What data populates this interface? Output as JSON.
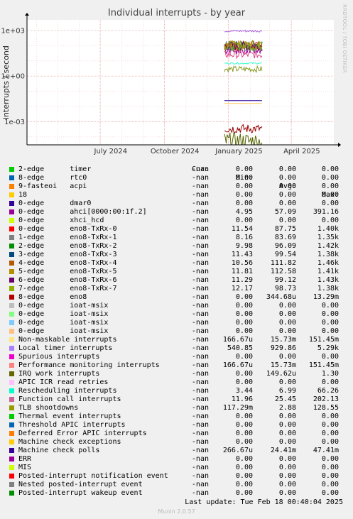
{
  "title": "Individual interrupts - by year",
  "side_label": "RRDTOOL / TOBI OETIKER",
  "footer": {
    "last_update": "Last update: Tue Feb 18 00:40:04 2025",
    "munin": "Munin 2.0.57"
  },
  "legend_header": {
    "cur": "Cur:",
    "min": "Min:",
    "avg": "Avg:",
    "max": "Max:"
  },
  "chart_data": {
    "type": "line",
    "title": "Individual interrupts - by year",
    "ylabel": "interrupts / second",
    "yscale": "log",
    "ylim": [
      3e-05,
      5000
    ],
    "yticks": [
      "1e+03",
      "1e+00",
      "1e-03"
    ],
    "xticks": [
      "July 2024",
      "October 2024",
      "January 2025",
      "April 2025"
    ],
    "grid": true,
    "data_start": "2024-12-26",
    "series": [
      {
        "name": "0-edge ahci[0000:00:1f.2]",
        "color": "#990099",
        "level": 57.09,
        "spread": 0.35
      },
      {
        "name": "0-edge eno8-TxRx-0",
        "color": "#ee1111",
        "level": 87.75,
        "spread": 0.3
      },
      {
        "name": "1-edge eno8-TxRx-1",
        "color": "#888888",
        "level": 83.69,
        "spread": 0.3
      },
      {
        "name": "2-edge eno8-TxRx-2",
        "color": "#228b22",
        "level": 96.09,
        "spread": 0.3
      },
      {
        "name": "3-edge eno8-TxRx-3",
        "color": "#336666",
        "level": 99.54,
        "spread": 0.3
      },
      {
        "name": "4-edge eno8-TxRx-4",
        "color": "#cc6600",
        "level": 111.82,
        "spread": 0.3
      },
      {
        "name": "5-edge eno8-TxRx-5",
        "color": "#aa9900",
        "level": 112.58,
        "spread": 0.3
      },
      {
        "name": "6-edge eno8-TxRx-6",
        "color": "#660066",
        "level": 99.12,
        "spread": 0.3
      },
      {
        "name": "7-edge eno8-TxRx-7",
        "color": "#88aa22",
        "level": 98.73,
        "spread": 0.3
      },
      {
        "name": "Local timer interrupts",
        "color": "#aa66dd",
        "level": 929.86,
        "spread": 0.08
      },
      {
        "name": "TLB shootdowns",
        "color": "#889922",
        "level": 2.88,
        "spread": 0.2
      },
      {
        "name": "Rescheduling interrupts",
        "color": "#33ffcc",
        "level": 6.99,
        "spread": 0.05
      },
      {
        "name": "Function call interrupts",
        "color": "#dd4488",
        "level": 25.45,
        "spread": 0.25
      },
      {
        "name": "Machine check polls",
        "color": "#220099",
        "level": 0.02441,
        "spread": 0.0
      },
      {
        "name": "8-edge eno8",
        "color": "#990000",
        "level": 0.00034468,
        "spread": 0.3
      },
      {
        "name": "IRQ work interrupts",
        "color": "#556600",
        "level": 5e-05,
        "spread": 0.6
      },
      {
        "name": "Non-maskable interrupts",
        "color": "#ffcc66",
        "level": 0.01573,
        "spread": 0.0
      }
    ]
  },
  "legend": [
    {
      "color": "#00cc00",
      "name": "2-edge      timer",
      "cur": "-nan",
      "min": "0.00",
      "avg": "0.00",
      "max": "0.00"
    },
    {
      "color": "#0066b3",
      "name": "8-edge      rtc0",
      "cur": "-nan",
      "min": "0.00",
      "avg": "0.00",
      "max": "0.00"
    },
    {
      "color": "#ff8000",
      "name": "9-fasteoi   acpi",
      "cur": "-nan",
      "min": "0.00",
      "avg": "0.00",
      "max": "0.00"
    },
    {
      "color": "#ffcc00",
      "name": "18",
      "cur": "-nan",
      "min": "0.00",
      "avg": "0.00",
      "max": "0.00"
    },
    {
      "color": "#330099",
      "name": "0-edge      dmar0",
      "cur": "-nan",
      "min": "0.00",
      "avg": "0.00",
      "max": "0.00"
    },
    {
      "color": "#990099",
      "name": "0-edge      ahci[0000:00:1f.2]",
      "cur": "-nan",
      "min": "4.95",
      "avg": "57.09",
      "max": "391.16"
    },
    {
      "color": "#ccff00",
      "name": "0-edge      xhci_hcd",
      "cur": "-nan",
      "min": "0.00",
      "avg": "0.00",
      "max": "0.00"
    },
    {
      "color": "#ff0000",
      "name": "0-edge      eno8-TxRx-0",
      "cur": "-nan",
      "min": "11.54",
      "avg": "87.75",
      "max": "1.40k"
    },
    {
      "color": "#808080",
      "name": "1-edge      eno8-TxRx-1",
      "cur": "-nan",
      "min": "8.16",
      "avg": "83.69",
      "max": "1.35k"
    },
    {
      "color": "#008f00",
      "name": "2-edge      eno8-TxRx-2",
      "cur": "-nan",
      "min": "9.98",
      "avg": "96.09",
      "max": "1.42k"
    },
    {
      "color": "#00487d",
      "name": "3-edge      eno8-TxRx-3",
      "cur": "-nan",
      "min": "11.43",
      "avg": "99.54",
      "max": "1.38k"
    },
    {
      "color": "#b35a00",
      "name": "4-edge      eno8-TxRx-4",
      "cur": "-nan",
      "min": "10.56",
      "avg": "111.82",
      "max": "1.46k"
    },
    {
      "color": "#b38f00",
      "name": "5-edge      eno8-TxRx-5",
      "cur": "-nan",
      "min": "11.81",
      "avg": "112.58",
      "max": "1.41k"
    },
    {
      "color": "#6b006b",
      "name": "6-edge      eno8-TxRx-6",
      "cur": "-nan",
      "min": "11.29",
      "avg": "99.12",
      "max": "1.43k"
    },
    {
      "color": "#8fb300",
      "name": "7-edge      eno8-TxRx-7",
      "cur": "-nan",
      "min": "12.17",
      "avg": "98.73",
      "max": "1.38k"
    },
    {
      "color": "#b30000",
      "name": "8-edge      eno8",
      "cur": "-nan",
      "min": "0.00",
      "avg": "344.68u",
      "max": "13.29m"
    },
    {
      "color": "#bebebe",
      "name": "0-edge      ioat-msix",
      "cur": "-nan",
      "min": "0.00",
      "avg": "0.00",
      "max": "0.00"
    },
    {
      "color": "#80ff80",
      "name": "0-edge      ioat-msix",
      "cur": "-nan",
      "min": "0.00",
      "avg": "0.00",
      "max": "0.00"
    },
    {
      "color": "#80c9ff",
      "name": "0-edge      ioat-msix",
      "cur": "-nan",
      "min": "0.00",
      "avg": "0.00",
      "max": "0.00"
    },
    {
      "color": "#ffc080",
      "name": "0-edge      ioat-msix",
      "cur": "-nan",
      "min": "0.00",
      "avg": "0.00",
      "max": "0.00"
    },
    {
      "color": "#ffe680",
      "name": "Non-maskable interrupts",
      "cur": "-nan",
      "min": "166.67u",
      "avg": "15.73m",
      "max": "151.45m"
    },
    {
      "color": "#aa80ff",
      "name": "Local timer interrupts",
      "cur": "-nan",
      "min": "540.85",
      "avg": "929.86",
      "max": "5.29k"
    },
    {
      "color": "#ee00cc",
      "name": "Spurious interrupts",
      "cur": "-nan",
      "min": "0.00",
      "avg": "0.00",
      "max": "0.00"
    },
    {
      "color": "#ff8080",
      "name": "Performance monitoring interrupts",
      "cur": "-nan",
      "min": "166.67u",
      "avg": "15.73m",
      "max": "151.45m"
    },
    {
      "color": "#666600",
      "name": "IRQ work interrupts",
      "cur": "-nan",
      "min": "0.00",
      "avg": "149.62u",
      "max": "1.30"
    },
    {
      "color": "#ffbfff",
      "name": "APIC ICR read retries",
      "cur": "-nan",
      "min": "0.00",
      "avg": "0.00",
      "max": "0.00"
    },
    {
      "color": "#00ffcc",
      "name": "Rescheduling interrupts",
      "cur": "-nan",
      "min": "3.44",
      "avg": "6.99",
      "max": "66.26"
    },
    {
      "color": "#cc6699",
      "name": "Function call interrupts",
      "cur": "-nan",
      "min": "11.96",
      "avg": "25.45",
      "max": "202.13"
    },
    {
      "color": "#999900",
      "name": "TLB shootdowns",
      "cur": "-nan",
      "min": "117.29m",
      "avg": "2.88",
      "max": "128.55"
    },
    {
      "color": "#00cc00",
      "name": "Thermal event interrupts",
      "cur": "-nan",
      "min": "0.00",
      "avg": "0.00",
      "max": "0.00"
    },
    {
      "color": "#0066b3",
      "name": "Threshold APIC interrupts",
      "cur": "-nan",
      "min": "0.00",
      "avg": "0.00",
      "max": "0.00"
    },
    {
      "color": "#ff8000",
      "name": "Deferred Error APIC interrupts",
      "cur": "-nan",
      "min": "0.00",
      "avg": "0.00",
      "max": "0.00"
    },
    {
      "color": "#ffcc00",
      "name": "Machine check exceptions",
      "cur": "-nan",
      "min": "0.00",
      "avg": "0.00",
      "max": "0.00"
    },
    {
      "color": "#330099",
      "name": "Machine check polls",
      "cur": "-nan",
      "min": "266.67u",
      "avg": "24.41m",
      "max": "47.41m"
    },
    {
      "color": "#990099",
      "name": "ERR",
      "cur": "-nan",
      "min": "0.00",
      "avg": "0.00",
      "max": "0.00"
    },
    {
      "color": "#ccff00",
      "name": "MIS",
      "cur": "-nan",
      "min": "0.00",
      "avg": "0.00",
      "max": "0.00"
    },
    {
      "color": "#ff0000",
      "name": "Posted-interrupt notification event",
      "cur": "-nan",
      "min": "0.00",
      "avg": "0.00",
      "max": "0.00"
    },
    {
      "color": "#808080",
      "name": "Nested posted-interrupt event",
      "cur": "-nan",
      "min": "0.00",
      "avg": "0.00",
      "max": "0.00"
    },
    {
      "color": "#008f00",
      "name": "Posted-interrupt wakeup event",
      "cur": "-nan",
      "min": "0.00",
      "avg": "0.00",
      "max": "0.00"
    }
  ]
}
